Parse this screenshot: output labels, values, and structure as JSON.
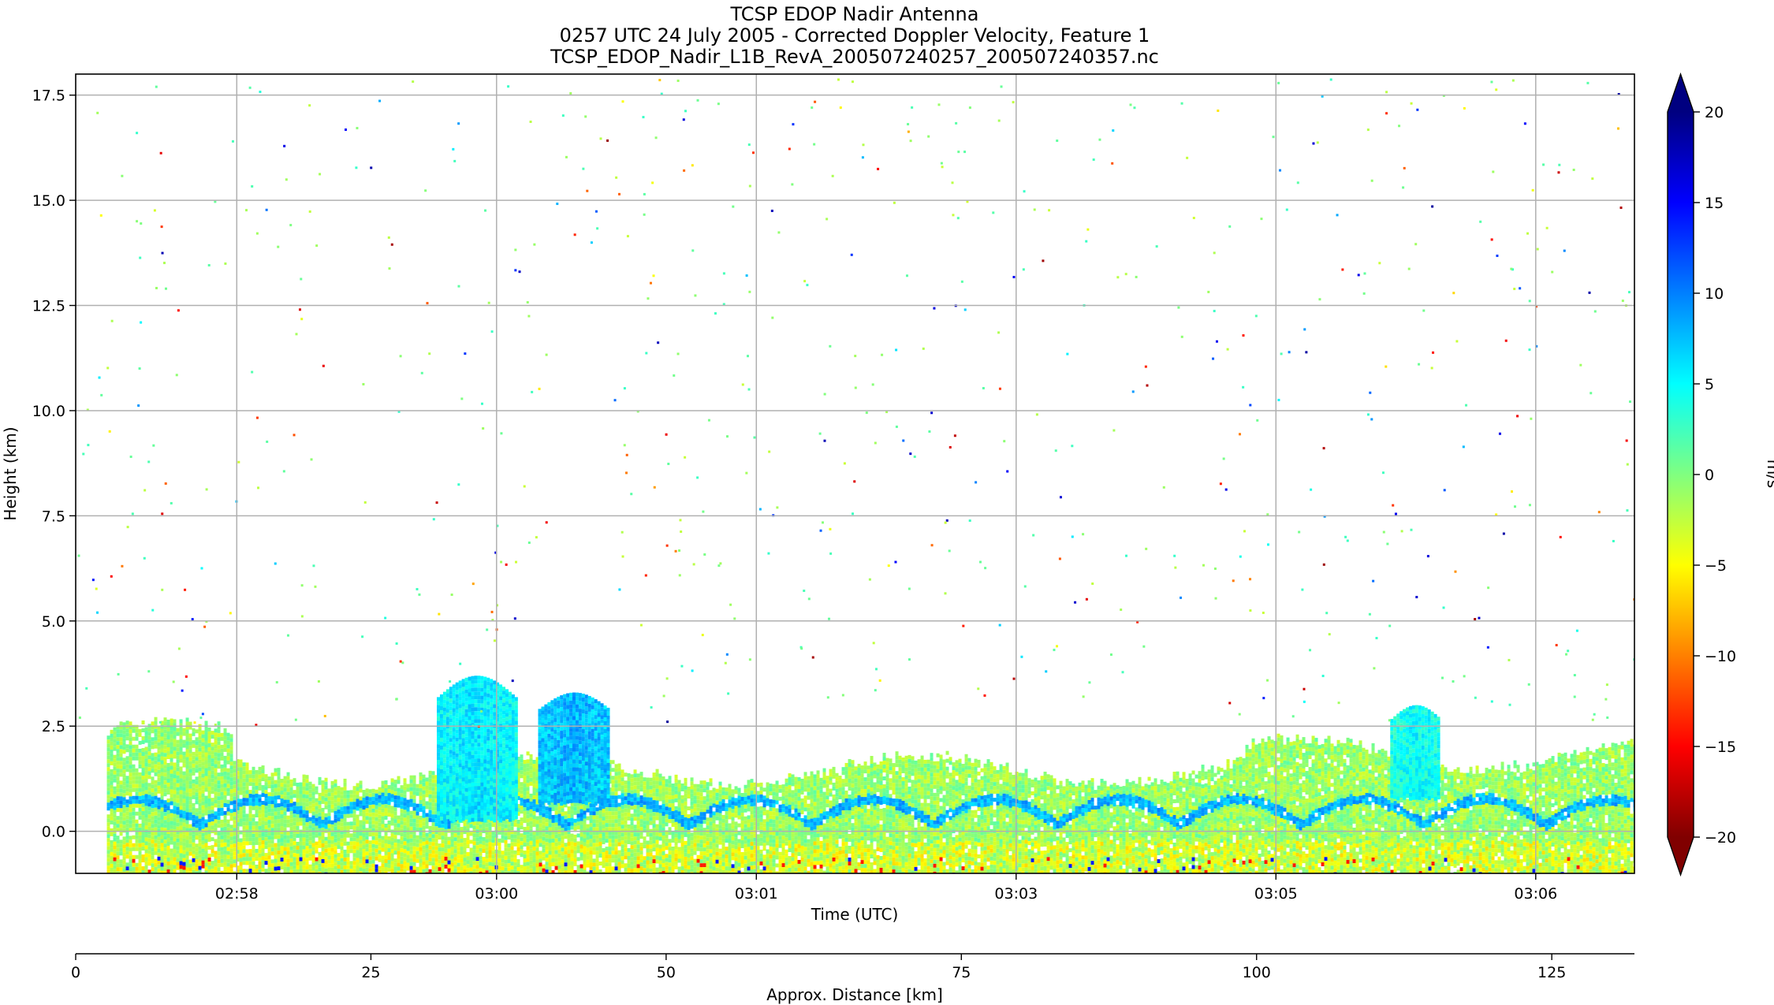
{
  "chart_data": {
    "type": "heatmap",
    "title_lines": [
      "TCSP EDOP Nadir Antenna",
      "0257 UTC 24 July 2005 - Corrected Doppler Velocity, Feature 1",
      "TCSP_EDOP_Nadir_L1B_RevA_200507240257_200507240357.nc"
    ],
    "xlabel": "Time (UTC)",
    "ylabel": "Height (km)",
    "x2label": "Approx. Distance [km]",
    "colorbar_label": "m/s",
    "colormap": "jet_r",
    "grid": true,
    "xlim_seconds_after_0257": [
      0,
      600
    ],
    "x_ticks": [
      {
        "label": "02:58",
        "sec": 62
      },
      {
        "label": "03:00",
        "sec": 162
      },
      {
        "label": "03:01",
        "sec": 262
      },
      {
        "label": "03:03",
        "sec": 362
      },
      {
        "label": "03:05",
        "sec": 462
      },
      {
        "label": "03:06",
        "sec": 562
      }
    ],
    "ylim": [
      -1.0,
      18.0
    ],
    "y_ticks": [
      {
        "label": "0.0",
        "value": 0.0
      },
      {
        "label": "2.5",
        "value": 2.5
      },
      {
        "label": "5.0",
        "value": 5.0
      },
      {
        "label": "7.5",
        "value": 7.5
      },
      {
        "label": "10.0",
        "value": 10.0
      },
      {
        "label": "12.5",
        "value": 12.5
      },
      {
        "label": "15.0",
        "value": 15.0
      },
      {
        "label": "17.5",
        "value": 17.5
      }
    ],
    "distance_lim_km": [
      0,
      132
    ],
    "distance_ticks": [
      {
        "label": "0",
        "value": 0
      },
      {
        "label": "25",
        "value": 25
      },
      {
        "label": "50",
        "value": 50
      },
      {
        "label": "75",
        "value": 75
      },
      {
        "label": "100",
        "value": 100
      },
      {
        "label": "125",
        "value": 125
      }
    ],
    "colorbar_range": [
      -20,
      20
    ],
    "colorbar_ticks": [
      {
        "label": "20",
        "value": 20
      },
      {
        "label": "15",
        "value": 15
      },
      {
        "label": "10",
        "value": 10
      },
      {
        "label": "5",
        "value": 5
      },
      {
        "label": "0",
        "value": 0
      },
      {
        "label": "−10",
        "value": -10
      },
      {
        "label": "−5",
        "value": -5
      },
      {
        "label": "−15",
        "value": -15
      },
      {
        "label": "−20",
        "value": -20
      }
    ],
    "features": [
      {
        "name": "boundary layer echo",
        "x_range": [
          12,
          600
        ],
        "height_km": [
          -1.0,
          2.2
        ],
        "velocity": 0
      },
      {
        "name": "convective cell",
        "x_range": [
          139,
          169
        ],
        "height_km": [
          0.3,
          3.7
        ],
        "velocity": 6
      },
      {
        "name": "convective cell",
        "x_range": [
          178,
          205
        ],
        "height_km": [
          0.7,
          3.3
        ],
        "velocity": 8
      },
      {
        "name": "convective cell",
        "x_range": [
          506,
          525
        ],
        "height_km": [
          0.8,
          3.0
        ],
        "velocity": 5
      }
    ],
    "palette": [
      "#800000",
      "#ff0000",
      "#ff8000",
      "#ffff00",
      "#80ff80",
      "#00ffff",
      "#0080ff",
      "#0000ff",
      "#000080"
    ]
  }
}
